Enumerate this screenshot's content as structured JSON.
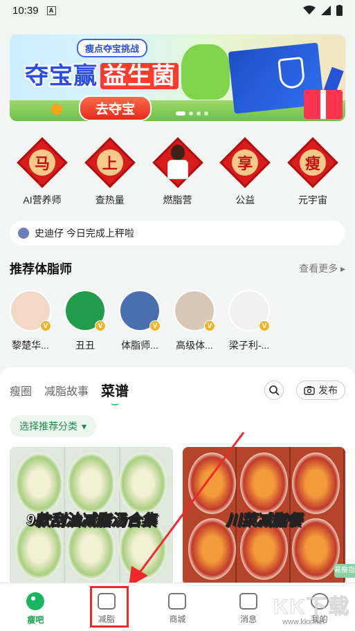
{
  "status": {
    "time": "10:39",
    "notif": "A"
  },
  "banner": {
    "tag": "瘦点夺宝挑战",
    "title_prefix": "夺宝赢",
    "title_highlight": "益生菌",
    "cta": "去夺宝"
  },
  "quick_actions": [
    {
      "char": "马",
      "label": "AI营养师"
    },
    {
      "char": "上",
      "label": "查热量"
    },
    {
      "char": "",
      "label": "燃脂营"
    },
    {
      "char": "享",
      "label": "公益"
    },
    {
      "char": "瘦",
      "label": "元宇宙"
    }
  ],
  "notice": {
    "text": "史迪仔 今日完成上秤啦"
  },
  "coaches_section": {
    "title": "推荐体脂师",
    "more": "查看更多 ▸"
  },
  "coaches": [
    {
      "name": "黎楚华...",
      "bg": "#f2d9c7"
    },
    {
      "name": "丑丑",
      "bg": "#1f9d4a"
    },
    {
      "name": "体脂师...",
      "bg": "#4a6fb0"
    },
    {
      "name": "高级体...",
      "bg": "#d9c7b8"
    },
    {
      "name": "梁子利-...",
      "bg": "#f1f1f1"
    }
  ],
  "feed": {
    "tabs": [
      {
        "label": "瘦圈",
        "active": false
      },
      {
        "label": "减脂故事",
        "active": false
      },
      {
        "label": "菜谱",
        "active": true
      }
    ],
    "publish": "发布",
    "filter": "选择推荐分类",
    "cards": [
      {
        "title": "9款刮油减脂汤合集"
      },
      {
        "title": "川菜减脂餐"
      }
    ],
    "side_tag": "易瘦指"
  },
  "bottom_nav": [
    {
      "label": "瘦吧",
      "active": true
    },
    {
      "label": "减脂",
      "active": false
    },
    {
      "label": "商城",
      "active": false
    },
    {
      "label": "消息",
      "active": false
    },
    {
      "label": "我的",
      "active": false
    }
  ],
  "watermark": {
    "text": "KK下载",
    "url": "www.kkx.net"
  },
  "colors": {
    "accent": "#19b55f",
    "highlight": "#ef2929",
    "banner_red": "#ff3b30"
  }
}
